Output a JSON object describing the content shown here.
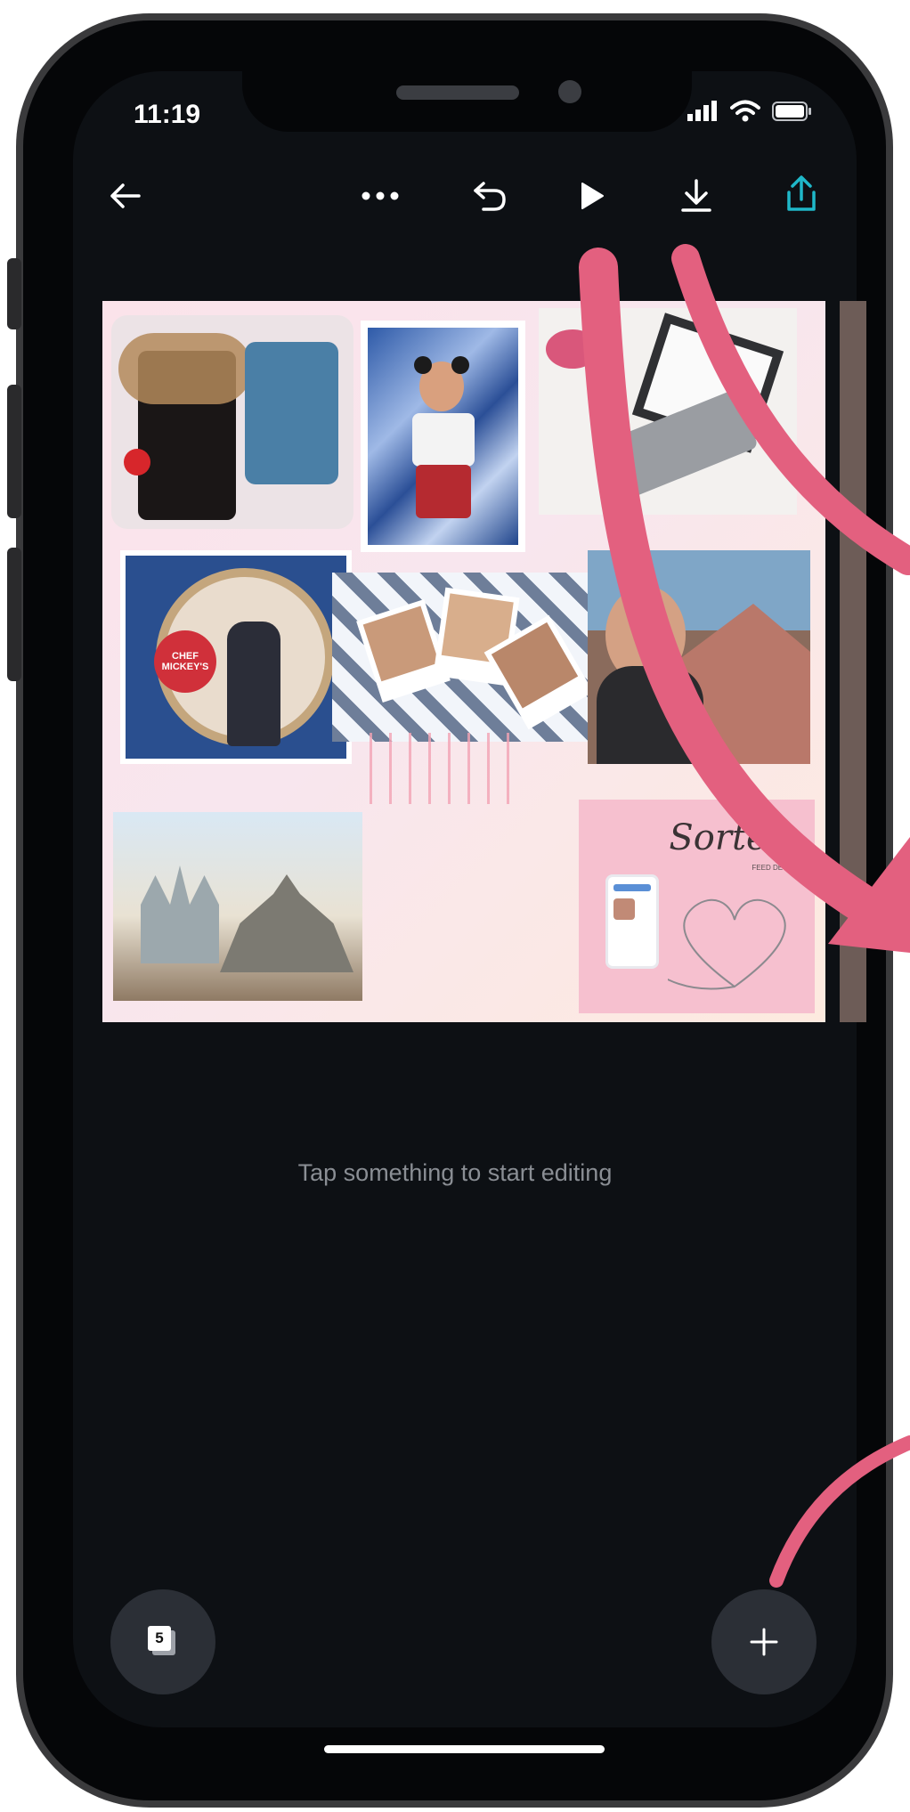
{
  "status_bar": {
    "time": "11:19"
  },
  "toolbar": {
    "icons": {
      "back": "arrow-left-icon",
      "more": "more-dots-icon",
      "undo": "undo-icon",
      "play": "play-icon",
      "download": "download-icon",
      "share": "share-upload-icon"
    },
    "accent_color": "#1fb8c9"
  },
  "canvas": {
    "sticker_title": "Sorteio",
    "sticker_subtitle": "FEED DE GIRL",
    "badge_text": "CHEF MICKEY'S"
  },
  "hint_text": "Tap something to start editing",
  "pages_button": {
    "count": "5"
  },
  "add_button": {
    "icon": "plus-icon"
  },
  "annotation_color": "#e3607f"
}
